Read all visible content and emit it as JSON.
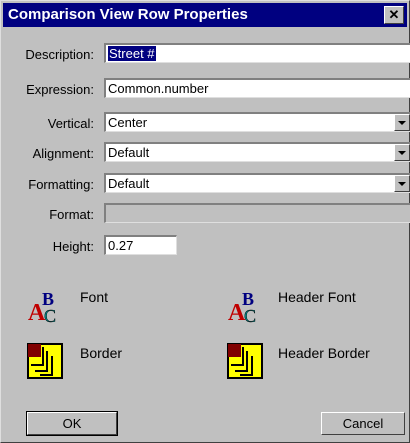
{
  "dialog": {
    "title": "Comparison View Row Properties",
    "close_label": "✕"
  },
  "fields": {
    "description": {
      "label": "Description:",
      "value": "Street #"
    },
    "expression": {
      "label": "Expression:",
      "value": "Common.number"
    },
    "vertical": {
      "label": "Vertical:",
      "value": "Center"
    },
    "alignment": {
      "label": "Alignment:",
      "value": "Default"
    },
    "formatting": {
      "label": "Formatting:",
      "value": "Default"
    },
    "format": {
      "label": "Format:",
      "value": ""
    },
    "height": {
      "label": "Height:",
      "value": "0.27"
    }
  },
  "options": {
    "font": "Font",
    "header_font": "Header Font",
    "border": "Border",
    "header_border": "Header Border"
  },
  "buttons": {
    "ok": "OK",
    "cancel": "Cancel"
  },
  "icons": {
    "font": "font-abc-icon",
    "border": "border-corner-icon"
  },
  "colors": {
    "titlebar": "#000080",
    "face": "#c0c0c0",
    "selection": "#000080"
  }
}
